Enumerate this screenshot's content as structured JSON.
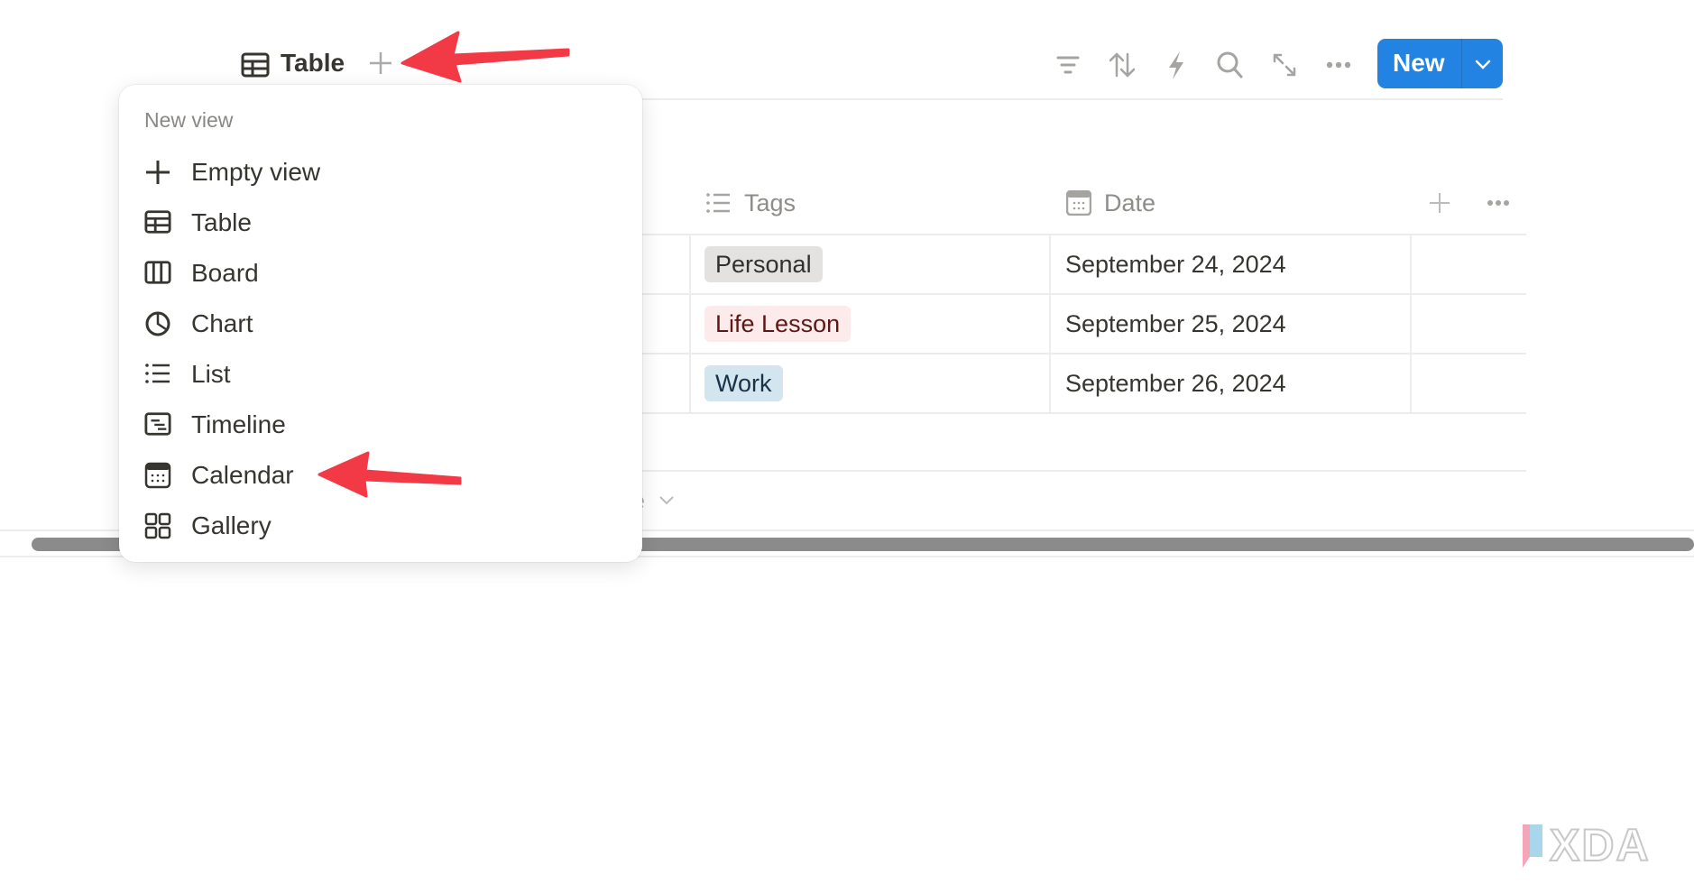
{
  "header": {
    "view_tab": "Table",
    "new_button": "New",
    "toolbar_icons": [
      "filter-icon",
      "sort-icon",
      "lightning-icon",
      "search-icon",
      "expand-icon",
      "more-icon"
    ],
    "accent": "#2383e2"
  },
  "table": {
    "columns": [
      {
        "label": "Tags",
        "icon": "list-icon"
      },
      {
        "label": "Date",
        "icon": "calendar-icon"
      }
    ],
    "rows": [
      {
        "tag": "Personal",
        "tag_bg": "#e3e2e0",
        "tag_fg": "#32302c",
        "date": "September 24, 2024"
      },
      {
        "tag": "Life Lesson",
        "tag_bg": "#fdebec",
        "tag_fg": "#5d1715",
        "date": "September 25, 2024"
      },
      {
        "tag": "Work",
        "tag_bg": "#d3e5ef",
        "tag_fg": "#183347",
        "date": "September 26, 2024"
      }
    ],
    "footer_partial": "e"
  },
  "menu": {
    "title": "New view",
    "items": [
      {
        "label": "Empty view",
        "icon": "plus-icon"
      },
      {
        "label": "Table",
        "icon": "table-icon"
      },
      {
        "label": "Board",
        "icon": "board-icon"
      },
      {
        "label": "Chart",
        "icon": "chart-icon"
      },
      {
        "label": "List",
        "icon": "list-icon"
      },
      {
        "label": "Timeline",
        "icon": "timeline-icon"
      },
      {
        "label": "Calendar",
        "icon": "calendar-icon"
      },
      {
        "label": "Gallery",
        "icon": "gallery-icon"
      }
    ]
  },
  "annotations": {
    "arrow_color": "#f23a46"
  },
  "watermark": "XDA"
}
